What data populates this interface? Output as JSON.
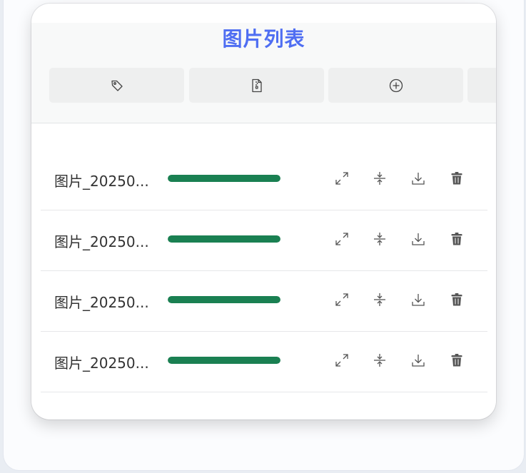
{
  "header": {
    "title": "图片列表"
  },
  "toolbar": {
    "buttons": [
      {
        "icon": "tag-icon"
      },
      {
        "icon": "file-zip-icon"
      },
      {
        "icon": "add-circle-icon"
      },
      {
        "icon": "more-icon"
      }
    ]
  },
  "list": {
    "items": [
      {
        "name": "图片_20250...",
        "progress": 1.0
      },
      {
        "name": "图片_20250...",
        "progress": 1.0
      },
      {
        "name": "图片_20250...",
        "progress": 1.0
      },
      {
        "name": "图片_20250...",
        "progress": 1.0
      }
    ],
    "actions": [
      "expand-icon",
      "compress-icon",
      "download-icon",
      "delete-icon"
    ]
  },
  "colors": {
    "accent": "#4f6ef2",
    "progress": "#1a8052",
    "icon": "#555555"
  }
}
